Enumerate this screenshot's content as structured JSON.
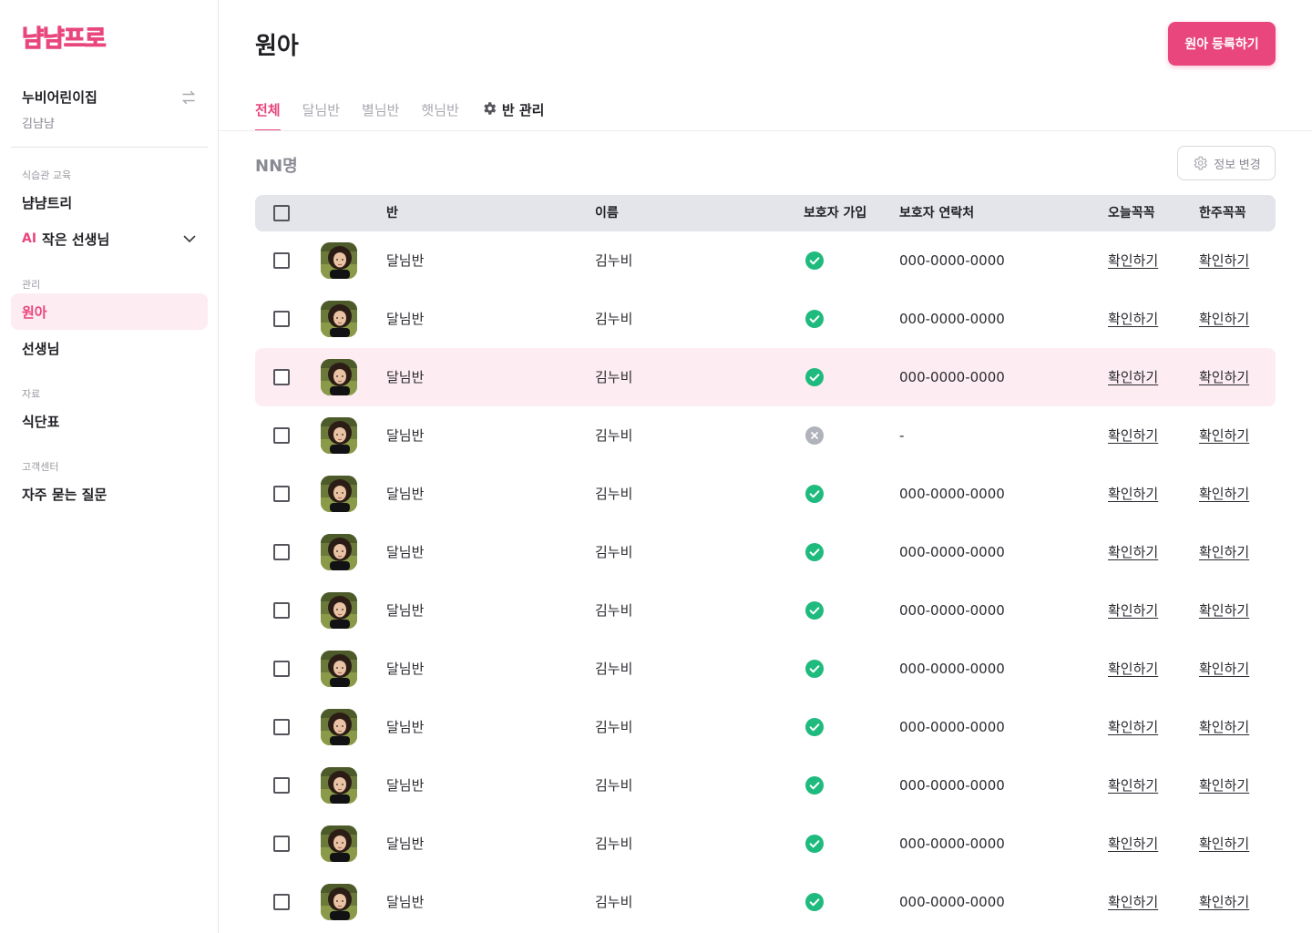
{
  "sidebar": {
    "logo": "냠냠프로",
    "org_name": "누비어린이집",
    "org_user": "김냠냠",
    "sections": [
      {
        "label": "식습관 교육"
      },
      {
        "label": "관리"
      },
      {
        "label": "자료"
      },
      {
        "label": "고객센터"
      }
    ],
    "items": {
      "tree": "냠냠트리",
      "ai_badge": "AI",
      "ai_teacher": "작은 선생님",
      "children": "원아",
      "teachers": "선생님",
      "menu": "식단표",
      "faq": "자주 묻는 질문"
    }
  },
  "header": {
    "title": "원아",
    "register_button": "원아 등록하기"
  },
  "tabs": [
    {
      "label": "전체",
      "active": true
    },
    {
      "label": "달님반"
    },
    {
      "label": "별님반"
    },
    {
      "label": "햇님반"
    },
    {
      "label": "반 관리",
      "icon": "gear-icon"
    }
  ],
  "toolbar": {
    "count": "NN명",
    "edit_button": "정보 변경"
  },
  "table": {
    "columns": [
      "반",
      "이름",
      "보호자 가입",
      "보호자 연락처",
      "오늘꼭꼭",
      "한주꼭꼭"
    ],
    "rows": [
      {
        "class": "달님반",
        "name": "김누비",
        "guardian_joined": true,
        "phone": "000-0000-0000",
        "today": "확인하기",
        "week": "확인하기"
      },
      {
        "class": "달님반",
        "name": "김누비",
        "guardian_joined": true,
        "phone": "000-0000-0000",
        "today": "확인하기",
        "week": "확인하기"
      },
      {
        "class": "달님반",
        "name": "김누비",
        "guardian_joined": true,
        "phone": "000-0000-0000",
        "today": "확인하기",
        "week": "확인하기",
        "highlighted": true
      },
      {
        "class": "달님반",
        "name": "김누비",
        "guardian_joined": false,
        "phone": "-",
        "today": "확인하기",
        "week": "확인하기"
      },
      {
        "class": "달님반",
        "name": "김누비",
        "guardian_joined": true,
        "phone": "000-0000-0000",
        "today": "확인하기",
        "week": "확인하기"
      },
      {
        "class": "달님반",
        "name": "김누비",
        "guardian_joined": true,
        "phone": "000-0000-0000",
        "today": "확인하기",
        "week": "확인하기"
      },
      {
        "class": "달님반",
        "name": "김누비",
        "guardian_joined": true,
        "phone": "000-0000-0000",
        "today": "확인하기",
        "week": "확인하기"
      },
      {
        "class": "달님반",
        "name": "김누비",
        "guardian_joined": true,
        "phone": "000-0000-0000",
        "today": "확인하기",
        "week": "확인하기"
      },
      {
        "class": "달님반",
        "name": "김누비",
        "guardian_joined": true,
        "phone": "000-0000-0000",
        "today": "확인하기",
        "week": "확인하기"
      },
      {
        "class": "달님반",
        "name": "김누비",
        "guardian_joined": true,
        "phone": "000-0000-0000",
        "today": "확인하기",
        "week": "확인하기"
      },
      {
        "class": "달님반",
        "name": "김누비",
        "guardian_joined": true,
        "phone": "000-0000-0000",
        "today": "확인하기",
        "week": "확인하기"
      },
      {
        "class": "달님반",
        "name": "김누비",
        "guardian_joined": true,
        "phone": "000-0000-0000",
        "today": "확인하기",
        "week": "확인하기"
      }
    ]
  },
  "colors": {
    "brand": "#e8467c",
    "success": "#1fba7e",
    "inactive": "#b0b2bc"
  }
}
